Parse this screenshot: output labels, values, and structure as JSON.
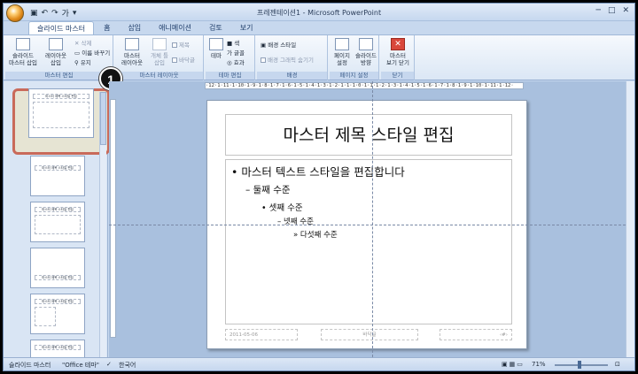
{
  "window": {
    "title": "프레젠테이션1 - Microsoft PowerPoint",
    "controls": [
      "─",
      "□",
      "✕"
    ]
  },
  "qat": {
    "icons": [
      "save-icon",
      "undo-icon",
      "redo-icon",
      "format-icon",
      "customize-icon"
    ],
    "glyphs": [
      "▣",
      "↶",
      "↷",
      "가",
      "▾"
    ]
  },
  "tabs": [
    {
      "label": "슬라이드 마스터",
      "active": true
    },
    {
      "label": "홈",
      "active": false
    },
    {
      "label": "삽입",
      "active": false
    },
    {
      "label": "애니메이션",
      "active": false
    },
    {
      "label": "검토",
      "active": false
    },
    {
      "label": "보기",
      "active": false
    }
  ],
  "ribbon": {
    "groups": {
      "edit_master": {
        "label": "마스터 편집",
        "insert_master": "슬라이드\n마스터 삽입",
        "insert_layout": "레이아웃\n삽입",
        "delete": "삭제",
        "rename": "이름 바꾸기",
        "preserve": "유지"
      },
      "master_layout": {
        "label": "마스터 레이아웃",
        "master_layout_btn": "마스터\n레이아웃",
        "insert_placeholder": "개체 틀\n삽입",
        "title_chk": "제목",
        "footer_chk": "바닥글"
      },
      "edit_theme": {
        "label": "테마 편집",
        "theme": "테마",
        "colors": "색",
        "fonts": "글꼴",
        "effects": "효과"
      },
      "background": {
        "label": "배경",
        "bg_styles": "배경 스타일",
        "hide_bg": "배경 그래픽 숨기기"
      },
      "page_setup": {
        "label": "페이지 설정",
        "page_setup_btn": "페이지\n설정",
        "orientation": "슬라이드\n방향"
      },
      "close": {
        "label": "닫기",
        "close_btn": "마스터\n보기 닫기"
      }
    }
  },
  "step_badge": "1",
  "thumbnails": {
    "master_title": "마스터 제목 스타일 편집",
    "layout_titles": [
      "마스터 제목 스타일 편집",
      "마스터 제목 스타일 편집",
      "마스터 제목 스타일 편집",
      "마스터 제목 스타일 편집",
      "마스터 제목 스타일 편집"
    ]
  },
  "ruler": {
    "horizontal": "·12·1·11·1·10·1·9·1·8·1·7·1·6·1·5·1·4·1·3·1·2·1·1·1·0·1·1·1·2·1·3·1·4·1·5·1·6·1·7·1·8·1·9·1·10·1·11·1·12·"
  },
  "slide": {
    "title": "마스터 제목 스타일 편집",
    "levels": [
      "•  마스터 텍스트 스타일을 편집합니다",
      "– 둘째 수준",
      "•  셋째 수준",
      "– 넷째 수준",
      "» 다섯째 수준"
    ],
    "footer_date": "2011-05-06",
    "footer_center": "바닥글",
    "footer_num": "‹#›"
  },
  "statusbar": {
    "view": "슬라이드 마스터",
    "theme": "\"Office 테마\"",
    "language": "한국어",
    "zoom": "71%"
  },
  "colors": {
    "ribbon_bg": "#dbe7f5",
    "highlight_border": "#c96a5a",
    "close_button": "#d9473b",
    "accent": "#1c3b68"
  }
}
